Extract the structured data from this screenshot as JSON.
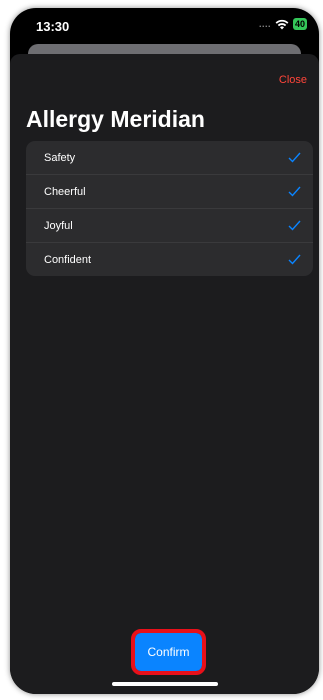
{
  "status_bar": {
    "time": "13:30",
    "signal": "....",
    "battery": "40"
  },
  "sheet": {
    "close_label": "Close",
    "title": "Allergy Meridian",
    "items": [
      {
        "label": "Safety",
        "checked": true
      },
      {
        "label": "Cheerful",
        "checked": true
      },
      {
        "label": "Joyful",
        "checked": true
      },
      {
        "label": "Confident",
        "checked": true
      }
    ],
    "confirm_label": "Confirm"
  },
  "colors": {
    "accent": "#0a84ff",
    "close": "#ff453a",
    "highlight": "#e8101a"
  }
}
